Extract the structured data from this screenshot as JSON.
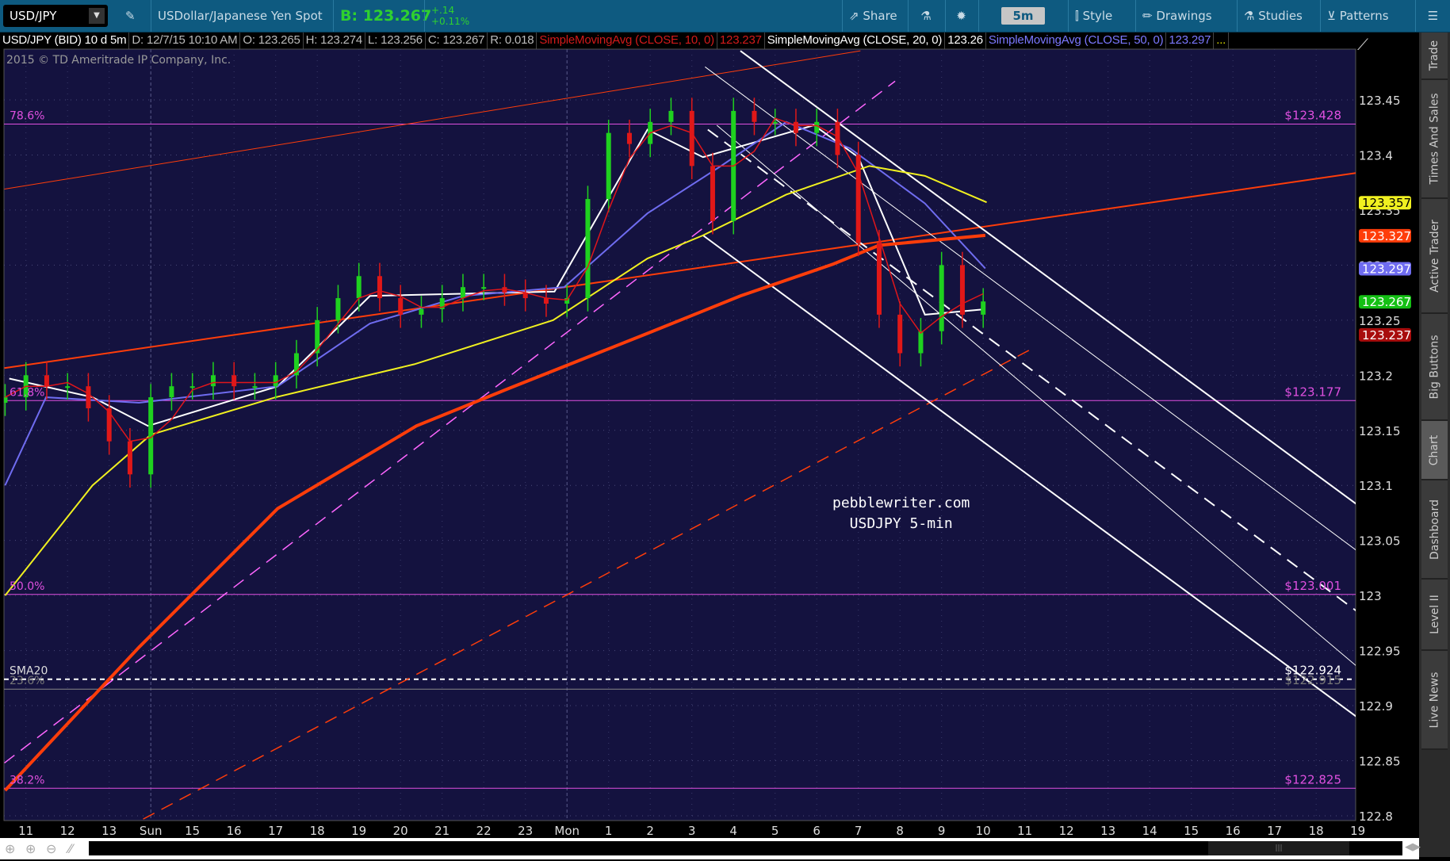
{
  "toolbar": {
    "symbol": "USD/JPY",
    "description": "USDollar/Japanese Yen Spot",
    "bid": "B: 123.267",
    "change": "+.14",
    "change_pct": "+0.11%",
    "share": "Share",
    "timeframe": "5m",
    "style": "Style",
    "drawings": "Drawings",
    "studies": "Studies",
    "patterns": "Patterns"
  },
  "infobar": {
    "title": "USD/JPY (BID) 10 d 5m",
    "date": "D: 12/7/15 10:10 AM",
    "open": "O: 123.265",
    "high": "H: 123.274",
    "low": "L: 123.256",
    "close": "C: 123.267",
    "range": "R: 0.018",
    "sma10_label": "SimpleMovingAvg (CLOSE, 10, 0)",
    "sma10_value": "123.237",
    "sma20_label": "SimpleMovingAvg (CLOSE, 20, 0)",
    "sma20_value": "123.26",
    "sma50_label": "SimpleMovingAvg (CLOSE, 50, 0)",
    "sma50_value": "123.297",
    "more": "..."
  },
  "copyright": "2015 © TD Ameritrade IP Company, Inc.",
  "watermark": {
    "line1": "pebblewriter.com",
    "line2": "USDJPY 5-min"
  },
  "sidetabs": [
    {
      "label": "Trade"
    },
    {
      "label": "Times And Sales"
    },
    {
      "label": "Active Trader"
    },
    {
      "label": "Big Buttons"
    },
    {
      "label": "Chart",
      "active": true
    },
    {
      "label": "Dashboard"
    },
    {
      "label": "Level II"
    },
    {
      "label": "Live News"
    }
  ],
  "colors": {
    "toolbar": "#0e5a80",
    "plot_bg": "#14123f",
    "sma10": "#e0161b",
    "sma20": "#ffffff",
    "sma50": "#6f6cf0",
    "yellow_ma": "#f0f020",
    "orange_ma": "#ff3d0a",
    "fib": "#e050e0",
    "bull": "#1fd11f",
    "bear": "#e01818"
  },
  "chart_data": {
    "type": "candlestick",
    "ylim": [
      122.8,
      123.47
    ],
    "y_ticks": [
      "123.45",
      "123.4",
      "123.35",
      "123.3",
      "123.25",
      "123.2",
      "123.15",
      "123.1",
      "123.05",
      "123",
      "122.95",
      "122.9",
      "122.85",
      "122.8"
    ],
    "x_ticks": [
      "11",
      "12",
      "13",
      "Sun",
      "15",
      "16",
      "17",
      "18",
      "19",
      "20",
      "21",
      "22",
      "23",
      "Mon",
      "1",
      "2",
      "3",
      "4",
      "5",
      "6",
      "7",
      "8",
      "9",
      "10",
      "11",
      "12",
      "13",
      "14",
      "15",
      "16",
      "17",
      "18",
      "19"
    ],
    "closes": [
      [
        "Sun 10:30",
        123.18
      ],
      [
        "Sun 11:00",
        123.2
      ],
      [
        "Sun 11:30",
        123.19
      ],
      [
        "Sun 12:00",
        123.19
      ],
      [
        "Sun 12:30",
        123.17
      ],
      [
        "Sun 13:00",
        123.14
      ],
      [
        "Sun 13:30",
        123.11
      ],
      [
        "Sun 14:00",
        123.18
      ],
      [
        "Sun 14:30",
        123.19
      ],
      [
        "Sun 15:00",
        123.19
      ],
      [
        "Sun 15:30",
        123.2
      ],
      [
        "Sun 16:00",
        123.19
      ],
      [
        "Sun 16:30",
        123.19
      ],
      [
        "Sun 17:00",
        123.2
      ],
      [
        "Sun 17:30",
        123.22
      ],
      [
        "Sun 18:00",
        123.25
      ],
      [
        "Sun 18:30",
        123.27
      ],
      [
        "Sun 19:00",
        123.29
      ],
      [
        "Sun 19:30",
        123.27
      ],
      [
        "Sun 20:00",
        123.255
      ],
      [
        "Sun 20:30",
        123.26
      ],
      [
        "Sun 21:00",
        123.27
      ],
      [
        "Sun 21:30",
        123.28
      ],
      [
        "Sun 22:00",
        123.28
      ],
      [
        "Sun 22:30",
        123.275
      ],
      [
        "Sun 23:00",
        123.27
      ],
      [
        "Sun 23:30",
        123.265
      ],
      [
        "Mon 00:00",
        123.27
      ],
      [
        "Mon 00:30",
        123.36
      ],
      [
        "Mon 01:00",
        123.42
      ],
      [
        "Mon 01:30",
        123.41
      ],
      [
        "Mon 02:00",
        123.43
      ],
      [
        "Mon 02:30",
        123.44
      ],
      [
        "Mon 03:00",
        123.39
      ],
      [
        "Mon 03:30",
        123.34
      ],
      [
        "Mon 04:00",
        123.44
      ],
      [
        "Mon 04:30",
        123.43
      ],
      [
        "Mon 05:00",
        123.43
      ],
      [
        "Mon 05:30",
        123.42
      ],
      [
        "Mon 06:00",
        123.43
      ],
      [
        "Mon 06:30",
        123.4
      ],
      [
        "Mon 07:00",
        123.32
      ],
      [
        "Mon 07:30",
        123.255
      ],
      [
        "Mon 08:00",
        123.22
      ],
      [
        "Mon 08:30",
        123.24
      ],
      [
        "Mon 09:00",
        123.3
      ],
      [
        "Mon 09:30",
        123.255
      ],
      [
        "Mon 10:00",
        123.267
      ]
    ],
    "series": [
      {
        "name": "SimpleMovingAvg (CLOSE, 20, 0)",
        "color": "#ffffff",
        "points": [
          [
            "Sun 10:36",
            123.197
          ],
          [
            "Sun 12:36",
            123.18
          ],
          [
            "Sun 13:56",
            123.154
          ],
          [
            "Sun 17:03",
            123.19
          ],
          [
            "Sun 19:16",
            123.272
          ],
          [
            "Sun 23:42",
            123.276
          ],
          [
            "Mon 01:56",
            123.423
          ],
          [
            "Mon 03:16",
            123.398
          ],
          [
            "Mon 05:56",
            123.427
          ],
          [
            "Mon 07:00",
            123.398
          ],
          [
            "Mon 08:36",
            123.255
          ],
          [
            "Mon 10:03",
            123.26
          ]
        ]
      },
      {
        "name": "SimpleMovingAvg (CLOSE, 50, 0)",
        "color": "#6f6cf0",
        "points": [
          [
            "Sun 10:30",
            123.1
          ],
          [
            "Sun 11:29",
            123.18
          ],
          [
            "Sun 13:43",
            123.175
          ],
          [
            "Sun 17:03",
            123.19
          ],
          [
            "Sun 19:16",
            123.247
          ],
          [
            "Sun 21:30",
            123.272
          ],
          [
            "Sun 23:56",
            123.28
          ],
          [
            "Mon 01:56",
            123.347
          ],
          [
            "Mon 03:42",
            123.39
          ],
          [
            "Mon 05:16",
            123.43
          ],
          [
            "Mon 06:48",
            123.406
          ],
          [
            "Mon 08:36",
            123.356
          ],
          [
            "Mon 10:03",
            123.297
          ]
        ]
      },
      {
        "color": "#f0f020",
        "points": [
          [
            "Sun 10:30",
            123.0
          ],
          [
            "Sun 12:36",
            123.1
          ],
          [
            "Sun 14:00",
            123.146
          ],
          [
            "Sun 17:00",
            123.18
          ],
          [
            "Sun 20:20",
            123.21
          ],
          [
            "Sun 23:40",
            123.25
          ],
          [
            "Mon 01:56",
            123.306
          ],
          [
            "Mon 03:16",
            123.327
          ],
          [
            "Mon 05:16",
            123.364
          ],
          [
            "Mon 07:16",
            123.39
          ],
          [
            "Mon 08:36",
            123.381
          ],
          [
            "Mon 10:05",
            123.357
          ]
        ]
      },
      {
        "color": "#ff3d0a",
        "points": [
          [
            "Sun 10:30",
            122.823
          ],
          [
            "Sun 13:43",
            122.953
          ],
          [
            "Sun 17:03",
            123.079
          ],
          [
            "Sun 20:23",
            123.154
          ],
          [
            "Sun 22:36",
            123.188
          ],
          [
            "Mon 01:56",
            123.238
          ],
          [
            "Mon 04:10",
            123.272
          ],
          [
            "Mon 06:24",
            123.301
          ],
          [
            "Mon 07:30",
            123.318
          ],
          [
            "Mon 10:03",
            123.327
          ]
        ]
      }
    ],
    "price_bubbles": [
      {
        "value": "123.357",
        "color": "#f0f020",
        "text": "#000"
      },
      {
        "value": "123.327",
        "color": "#ff3d0a",
        "text": "#fff"
      },
      {
        "value": "123.297",
        "color": "#6f6cf0",
        "text": "#fff"
      },
      {
        "value": "123.267",
        "color": "#14c014",
        "text": "#fff"
      },
      {
        "value": "123.237",
        "color": "#a80d0d",
        "text": "#fff"
      }
    ],
    "fib_levels": [
      {
        "pct": "78.6%",
        "price": 123.428,
        "label": "$123.428"
      },
      {
        "pct": "61.8%",
        "price": 123.177,
        "label": "$123.177"
      },
      {
        "pct": "50.0%",
        "price": 123.001,
        "label": "$123.001"
      },
      {
        "pct": "23.6%",
        "price": 122.915,
        "label": "$122.915"
      },
      {
        "pct": "38.2%",
        "price": 122.825,
        "label": "$122.825"
      }
    ],
    "sma20_line": {
      "label": "SMA20",
      "price": 122.924,
      "value": "$122.924"
    },
    "drawings": [
      {
        "color": "#ff3d0a",
        "width": 1,
        "dash": false,
        "from": [
          "Sun 10:29",
          123.369
        ],
        "to": [
          "Mon 07:03",
          123.4945
        ]
      },
      {
        "color": "#ff3d0a",
        "width": 2,
        "dash": false,
        "from": [
          "Sun 10:29",
          123.2065
        ],
        "to": [
          "Mon 18:58",
          123.3837
        ]
      },
      {
        "color": "#ff66ff",
        "width": 1.5,
        "dash": true,
        "from": [
          "Sun 10:29",
          122.848
        ],
        "to": [
          "Mon 07:53",
          123.467
        ]
      },
      {
        "color": "#ff3d0a",
        "width": 1.5,
        "dash": true,
        "from": [
          "Sun 13:49",
          122.797
        ],
        "to": [
          "Mon 11:10",
          123.224
        ]
      },
      {
        "color": "#ffffff",
        "width": 2,
        "dash": false,
        "from": [
          "Mon 04:10",
          123.4945
        ],
        "to": [
          "Mon 18:58",
          123.083
        ]
      },
      {
        "color": "#ffffff",
        "width": 1,
        "dash": false,
        "from": [
          "Mon 03:19",
          123.48
        ],
        "to": [
          "Mon 18:58",
          123.041
        ]
      },
      {
        "color": "#ffffff",
        "width": 2,
        "dash": true,
        "from": [
          "Mon 03:23",
          123.423
        ],
        "to": [
          "Mon 18:58",
          122.986
        ]
      },
      {
        "color": "#ffffff",
        "width": 1,
        "dash": false,
        "from": [
          "Mon 03:36",
          123.427
        ],
        "to": [
          "Mon 18:58",
          122.936
        ]
      },
      {
        "color": "#ffffff",
        "width": 2,
        "dash": false,
        "from": [
          "Mon 03:16",
          123.327
        ],
        "to": [
          "Mon 18:58",
          122.89
        ]
      }
    ]
  }
}
